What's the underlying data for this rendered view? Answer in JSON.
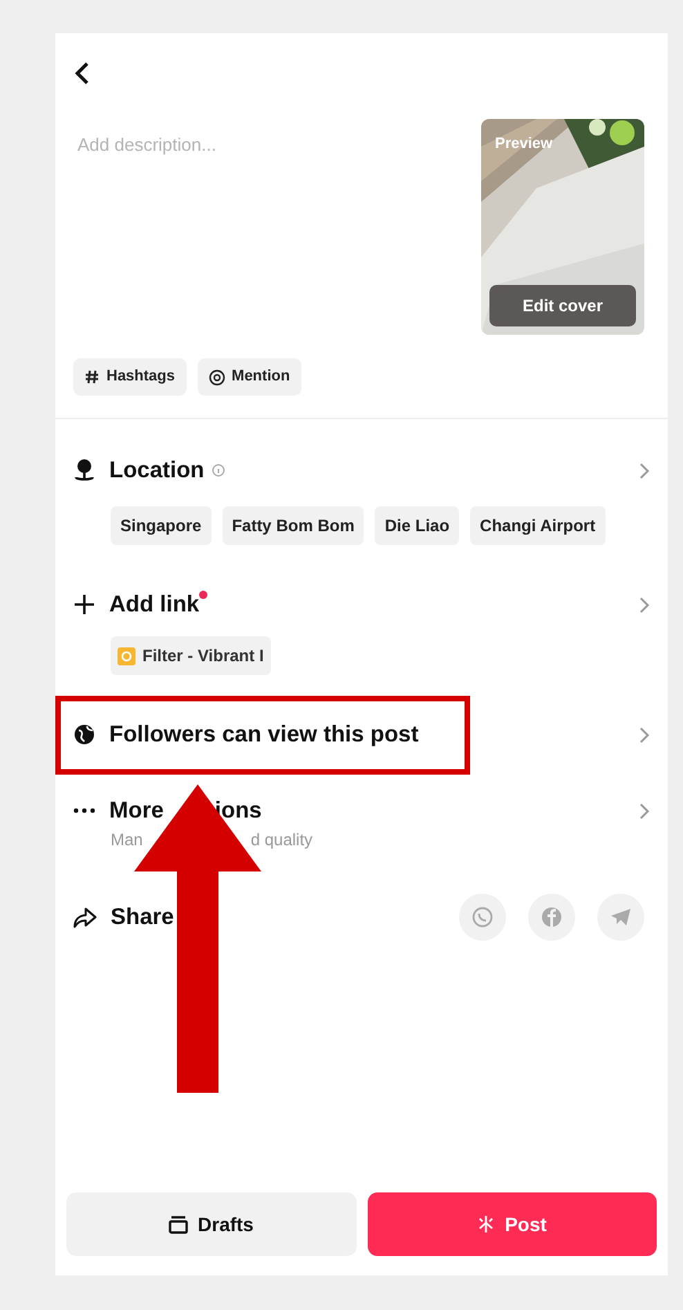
{
  "description": {
    "placeholder": "Add description..."
  },
  "cover": {
    "label": "Preview",
    "button": "Edit cover"
  },
  "tags": [
    {
      "kind": "hashtag",
      "label": "Hashtags"
    },
    {
      "kind": "mention",
      "label": "Mention"
    }
  ],
  "location": {
    "title": "Location",
    "suggestions": [
      "Singapore",
      "Fatty Bom Bom",
      "Die Liao",
      "Changi Airport"
    ]
  },
  "add_link": {
    "title": "Add link",
    "new_badge": true,
    "chips": [
      "Filter - Vibrant I"
    ]
  },
  "privacy": {
    "title": "Followers can view this post"
  },
  "more_options": {
    "title_parts": [
      "More",
      "ions"
    ],
    "subtitle_parts": [
      "Man",
      "d quality"
    ]
  },
  "share": {
    "title": "Share"
  },
  "actions": [
    {
      "kind": "drafts",
      "label": "Drafts"
    },
    {
      "kind": "post",
      "label": "Post"
    }
  ]
}
